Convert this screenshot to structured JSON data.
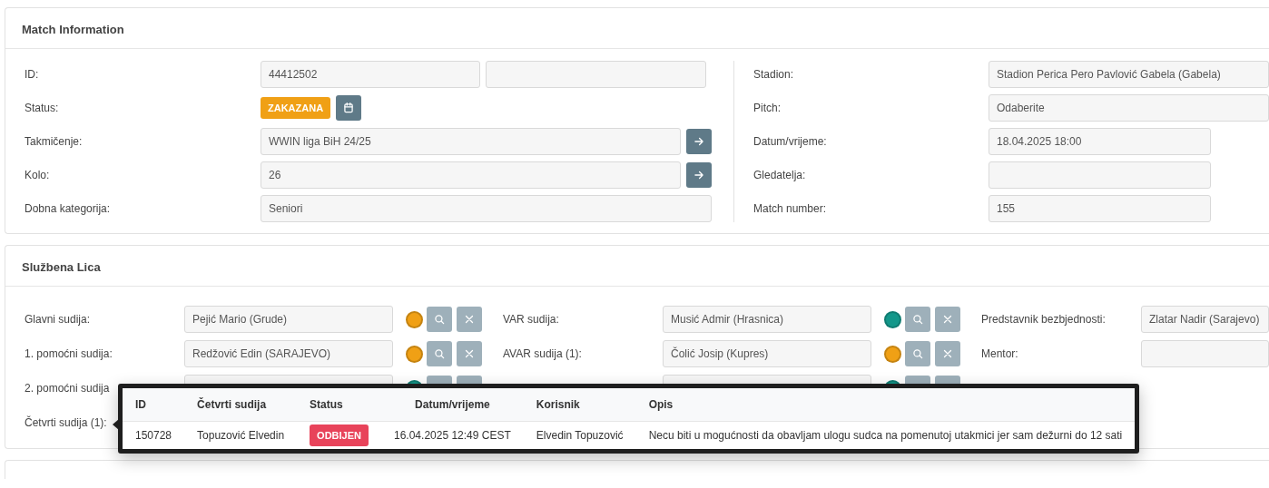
{
  "match_information": {
    "title": "Match Information",
    "left_rows": [
      {
        "kind": "double_field",
        "label": "ID:",
        "value": "44412502"
      },
      {
        "kind": "status",
        "label": "Status:",
        "status": "ZAKAZANA"
      },
      {
        "kind": "field_link",
        "label": "Takmičenje:",
        "value": "WWIN liga BiH 24/25"
      },
      {
        "kind": "field_link",
        "label": "Kolo:",
        "value": "26"
      },
      {
        "kind": "field",
        "label": "Dobna kategorija:",
        "value": "Seniori"
      }
    ],
    "right_rows": [
      {
        "kind": "wide_field",
        "label": "Stadion:",
        "value": "Stadion Perica Pero Pavlović Gabela (Gabela)"
      },
      {
        "kind": "wide_field",
        "label": "Pitch:",
        "value": "Odaberite"
      },
      {
        "kind": "field",
        "label": "Datum/vrijeme:",
        "value": "18.04.2025 18:00"
      },
      {
        "kind": "field",
        "label": "Gledatelja:"
      },
      {
        "kind": "field",
        "label": "Match number:",
        "value": "155"
      }
    ]
  },
  "officials": {
    "title": "Službena Lica",
    "rows": [
      [
        {
          "kind": "official",
          "label": "Glavni sudija:",
          "value": "Pejić Mario (Grude)",
          "color": "#f0a015"
        },
        {
          "kind": "official",
          "label": "VAR sudija:",
          "value": "Musić Admir (Hrasnica)",
          "color": "#13978a"
        },
        {
          "kind": "plain",
          "label": "Predstavnik bezbjednosti:",
          "value": "Zlatar Nadir (Sarajevo)"
        }
      ],
      [
        {
          "kind": "official",
          "label": "1. pomoćni sudija:",
          "value": "Redžović Edin (SARAJEVO)",
          "color": "#f0a015"
        },
        {
          "kind": "official",
          "label": "AVAR sudija (1):",
          "value": "Čolić Josip (Kupres)",
          "color": "#f0a015"
        },
        {
          "kind": "plain",
          "label": "Mentor:"
        }
      ],
      [
        {
          "kind": "official",
          "label": "2. pomoćni sudija",
          "color": "#13978a"
        },
        {
          "kind": "official",
          "color": "#13978a"
        }
      ],
      [
        {
          "kind": "label_only",
          "label": "Četvrti sudija (1):"
        }
      ]
    ]
  },
  "history_popup": {
    "columns": [
      "ID",
      "Četvrti sudija",
      "Status",
      "Datum/vrijeme",
      "Korisnik",
      "Opis"
    ],
    "rows": [
      {
        "id": "150728",
        "official": "Topuzović Elvedin",
        "status": "ODBIJEN",
        "datetime": "16.04.2025 12:49 CEST",
        "user": "Elvedin Topuzović",
        "description": "Necu biti u mogućnosti da obavljam ulogu sudca na pomenutoj utakmici jer sam dežurni do 12 sati"
      }
    ]
  }
}
